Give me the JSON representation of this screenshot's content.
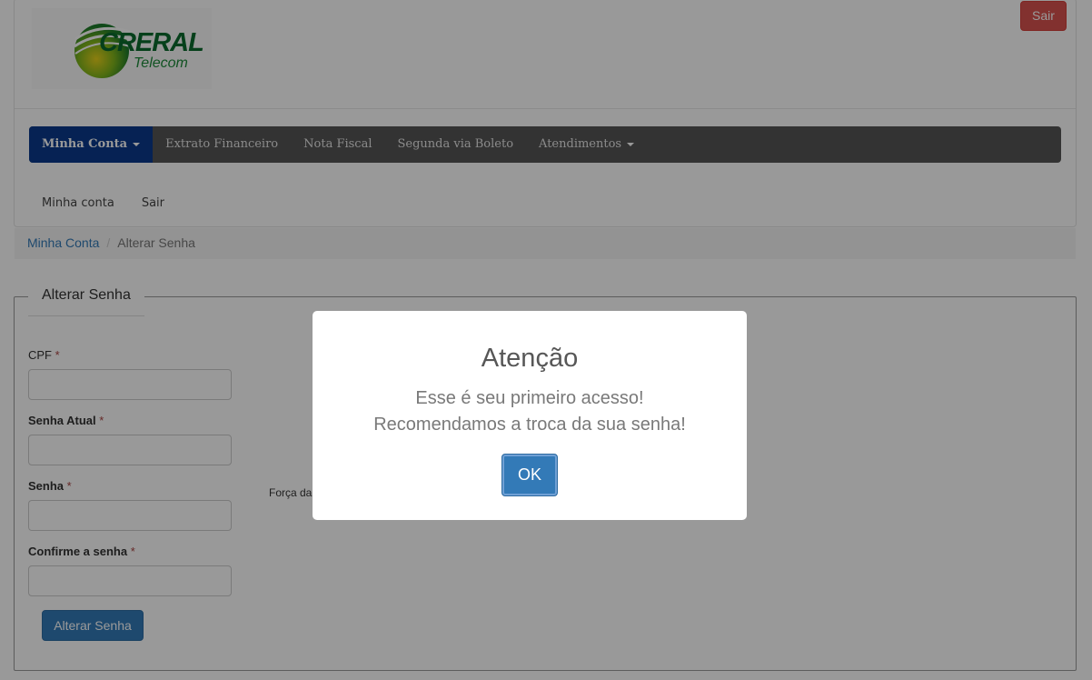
{
  "header": {
    "logo_main": "CRERAL",
    "logo_sub": "Telecom",
    "logout_button": "Sair"
  },
  "navbar": {
    "items": [
      {
        "label": "Minha Conta",
        "active": true,
        "dropdown": true
      },
      {
        "label": "Extrato Financeiro"
      },
      {
        "label": "Nota Fiscal"
      },
      {
        "label": "Segunda via Boleto"
      },
      {
        "label": "Atendimentos",
        "dropdown": true
      }
    ]
  },
  "subnav": {
    "items": [
      "Minha conta",
      "Sair"
    ]
  },
  "breadcrumb": {
    "parent": "Minha Conta",
    "separator": "/",
    "current": "Alterar Senha"
  },
  "form": {
    "legend": "Alterar Senha",
    "fields": [
      {
        "label": "CPF",
        "required_mark": "*",
        "value": ""
      },
      {
        "label": "Senha Atual",
        "required_mark": "*",
        "value": ""
      },
      {
        "label": "Senha",
        "required_mark": "*",
        "value": ""
      },
      {
        "label": "Confirme a senha",
        "required_mark": "*",
        "value": ""
      }
    ],
    "strength_label": "Força da",
    "submit_label": "Alterar Senha"
  },
  "modal": {
    "title": "Atenção",
    "line1": "Esse é seu primeiro acesso!",
    "line2": "Recomendamos a troca da sua senha!",
    "ok_label": "OK"
  },
  "colors": {
    "nav_active": "#0a3a8c",
    "navbar_bg": "#555555",
    "danger": "#d9534f",
    "primary": "#337ab7"
  }
}
